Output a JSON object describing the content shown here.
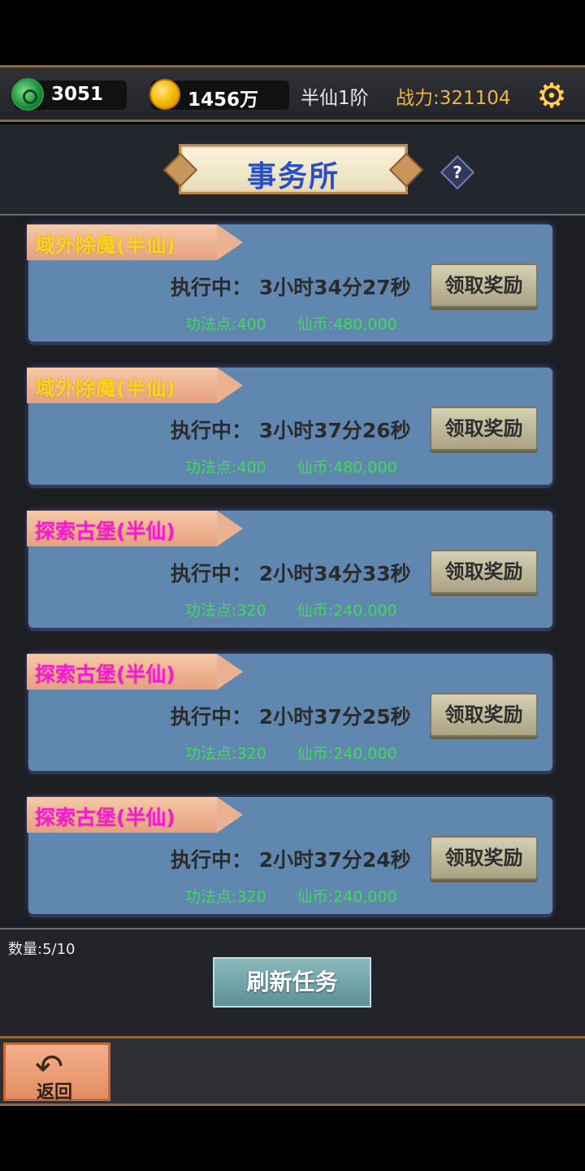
{
  "topbar": {
    "jade_count": "3051",
    "gold_count": "1456万",
    "rank": "半仙1阶",
    "power": "战力:321104"
  },
  "header": {
    "title": "事务所",
    "help_label": "?"
  },
  "tasks": [
    {
      "name": "域外除魔(半仙)",
      "name_color": "#ffd21a",
      "status": "执行中：  3小时34分27秒",
      "reward_gongfa": "功法点:400",
      "reward_coin": "仙币:480,000",
      "claim_label": "领取奖励"
    },
    {
      "name": "域外除魔(半仙)",
      "name_color": "#ffd21a",
      "status": "执行中：  3小时37分26秒",
      "reward_gongfa": "功法点:400",
      "reward_coin": "仙币:480,000",
      "claim_label": "领取奖励"
    },
    {
      "name": "探索古堡(半仙)",
      "name_color": "#ff16d8",
      "status": "执行中：  2小时34分33秒",
      "reward_gongfa": "功法点:320",
      "reward_coin": "仙币:240,000",
      "claim_label": "领取奖励"
    },
    {
      "name": "探索古堡(半仙)",
      "name_color": "#ff16d8",
      "status": "执行中：  2小时37分25秒",
      "reward_gongfa": "功法点:320",
      "reward_coin": "仙币:240,000",
      "claim_label": "领取奖励"
    },
    {
      "name": "探索古堡(半仙)",
      "name_color": "#ff16d8",
      "status": "执行中：  2小时37分24秒",
      "reward_gongfa": "功法点:320",
      "reward_coin": "仙币:240,000",
      "claim_label": "领取奖励"
    }
  ],
  "footer": {
    "count": "数量:5/10",
    "refresh_label": "刷新任务",
    "back_label": "返回",
    "back_icon": "↶"
  }
}
